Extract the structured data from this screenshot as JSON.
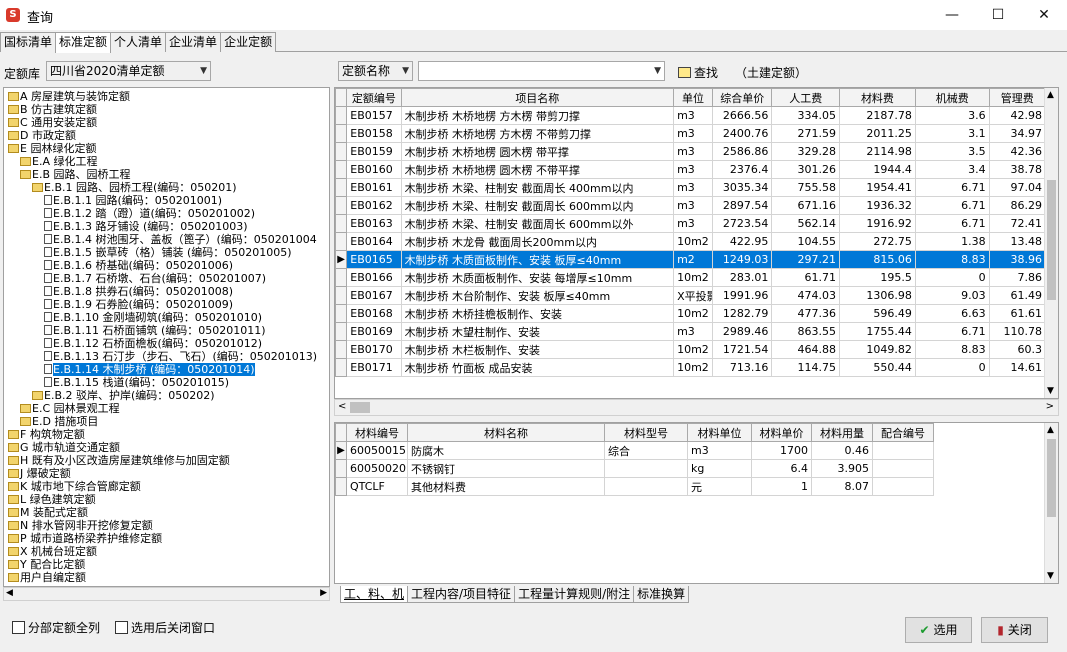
{
  "window": {
    "title": "查询",
    "min_icon": "—",
    "max_icon": "☐",
    "close_icon": "✕"
  },
  "tabs": [
    "国标清单",
    "标准定额",
    "个人清单",
    "企业清单",
    "企业定额"
  ],
  "active_tab": 1,
  "toolbar": {
    "library_label": "定额库",
    "library_value": "四川省2020清单定额",
    "search_field": "定额名称",
    "search_value": "",
    "find_label": "查找",
    "scope_label": "（土建定额）"
  },
  "tree": [
    {
      "d": 0,
      "t": "A 房屋建筑与装饰定额",
      "i": "folder"
    },
    {
      "d": 0,
      "t": "B 仿古建筑定额",
      "i": "folder"
    },
    {
      "d": 0,
      "t": "C 通用安装定额",
      "i": "folder"
    },
    {
      "d": 0,
      "t": "D 市政定额",
      "i": "folder"
    },
    {
      "d": 0,
      "t": "E 园林绿化定额",
      "i": "folder"
    },
    {
      "d": 1,
      "t": "E.A 绿化工程",
      "i": "folder"
    },
    {
      "d": 1,
      "t": "E.B 园路、园桥工程",
      "i": "folder"
    },
    {
      "d": 2,
      "t": "E.B.1 园路、园桥工程(编码：050201)",
      "i": "folder"
    },
    {
      "d": 3,
      "t": "E.B.1.1 园路(编码：050201001)",
      "i": "doc"
    },
    {
      "d": 3,
      "t": "E.B.1.2 踏（蹬）道(编码：050201002)",
      "i": "doc"
    },
    {
      "d": 3,
      "t": "E.B.1.3 路牙铺设 (编码：050201003)",
      "i": "doc"
    },
    {
      "d": 3,
      "t": "E.B.1.4 树池围牙、盖板（篦子）(编码：050201004",
      "i": "doc"
    },
    {
      "d": 3,
      "t": "E.B.1.5 嵌草砖（格）铺装 (编码：050201005)",
      "i": "doc"
    },
    {
      "d": 3,
      "t": "E.B.1.6 桥基础(编码：050201006)",
      "i": "doc"
    },
    {
      "d": 3,
      "t": "E.B.1.7 石桥墩、石台(编码：050201007)",
      "i": "doc"
    },
    {
      "d": 3,
      "t": "E.B.1.8 拱券石(编码：050201008)",
      "i": "doc"
    },
    {
      "d": 3,
      "t": "E.B.1.9 石券脸(编码：050201009)",
      "i": "doc"
    },
    {
      "d": 3,
      "t": "E.B.1.10 金刚墙砌筑(编码：050201010)",
      "i": "doc"
    },
    {
      "d": 3,
      "t": "E.B.1.11 石桥面铺筑 (编码：050201011)",
      "i": "doc"
    },
    {
      "d": 3,
      "t": "E.B.1.12 石桥面檐板(编码：050201012)",
      "i": "doc"
    },
    {
      "d": 3,
      "t": "E.B.1.13 石汀步（步石、飞石）(编码：050201013)",
      "i": "doc"
    },
    {
      "d": 3,
      "t": "E.B.1.14 木制步桥 (编码：050201014)",
      "i": "doc",
      "sel": true
    },
    {
      "d": 3,
      "t": "E.B.1.15 栈道(编码：050201015)",
      "i": "doc"
    },
    {
      "d": 2,
      "t": "E.B.2 驳岸、护岸(编码：050202)",
      "i": "folder"
    },
    {
      "d": 1,
      "t": "E.C 园林景观工程",
      "i": "folder"
    },
    {
      "d": 1,
      "t": "E.D 措施项目",
      "i": "folder"
    },
    {
      "d": 0,
      "t": "F 构筑物定额",
      "i": "folder"
    },
    {
      "d": 0,
      "t": "G 城市轨道交通定额",
      "i": "folder"
    },
    {
      "d": 0,
      "t": "H 既有及小区改造房屋建筑维修与加固定额",
      "i": "folder"
    },
    {
      "d": 0,
      "t": "J 爆破定额",
      "i": "folder"
    },
    {
      "d": 0,
      "t": "K 城市地下综合管廊定额",
      "i": "folder"
    },
    {
      "d": 0,
      "t": "L 绿色建筑定额",
      "i": "folder"
    },
    {
      "d": 0,
      "t": "M 装配式定额",
      "i": "folder"
    },
    {
      "d": 0,
      "t": "N 排水管网非开挖修复定额",
      "i": "folder"
    },
    {
      "d": 0,
      "t": "P 城市道路桥梁养护维修定额",
      "i": "folder"
    },
    {
      "d": 0,
      "t": "X 机械台班定额",
      "i": "folder"
    },
    {
      "d": 0,
      "t": "Y 配合比定额",
      "i": "folder"
    },
    {
      "d": 0,
      "t": "用户自编定额",
      "i": "folder"
    }
  ],
  "quota_table": {
    "headers": [
      "定额编号",
      "项目名称",
      "单位",
      "综合单价",
      "人工费",
      "材料费",
      "机械费",
      "管理费"
    ],
    "rows": [
      [
        "EB0157",
        "木制步桥 木桥地楞 方木楞 带剪刀撑",
        "m3",
        "2666.56",
        "334.05",
        "2187.78",
        "3.6",
        "42.98"
      ],
      [
        "EB0158",
        "木制步桥 木桥地楞 方木楞 不带剪刀撑",
        "m3",
        "2400.76",
        "271.59",
        "2011.25",
        "3.1",
        "34.97"
      ],
      [
        "EB0159",
        "木制步桥 木桥地楞 圆木楞 带平撑",
        "m3",
        "2586.86",
        "329.28",
        "2114.98",
        "3.5",
        "42.36"
      ],
      [
        "EB0160",
        "木制步桥 木桥地楞 圆木楞 不带平撑",
        "m3",
        "2376.4",
        "301.26",
        "1944.4",
        "3.4",
        "38.78"
      ],
      [
        "EB0161",
        "木制步桥 木梁、柱制安 截面周长 400mm以内",
        "m3",
        "3035.34",
        "755.58",
        "1954.41",
        "6.71",
        "97.04"
      ],
      [
        "EB0162",
        "木制步桥 木梁、柱制安 截面周长 600mm以内",
        "m3",
        "2897.54",
        "671.16",
        "1936.32",
        "6.71",
        "86.29"
      ],
      [
        "EB0163",
        "木制步桥 木梁、柱制安 截面周长 600mm以外",
        "m3",
        "2723.54",
        "562.14",
        "1916.92",
        "6.71",
        "72.41"
      ],
      [
        "EB0164",
        "木制步桥 木龙骨 截面周长200mm以内",
        "10m2",
        "422.95",
        "104.55",
        "272.75",
        "1.38",
        "13.48"
      ],
      [
        "EB0165",
        "木制步桥 木质面板制作、安装 板厚≤40mm",
        "m2",
        "1249.03",
        "297.21",
        "815.06",
        "8.83",
        "38.96"
      ],
      [
        "EB0166",
        "木制步桥 木质面板制作、安装 每增厚≤10mm",
        "10m2",
        "283.01",
        "61.71",
        "195.5",
        "0",
        "7.86"
      ],
      [
        "EB0167",
        "木制步桥 木台阶制作、安装 板厚≤40mm",
        "X平投影",
        "1991.96",
        "474.03",
        "1306.98",
        "9.03",
        "61.49"
      ],
      [
        "EB0168",
        "木制步桥 木桥挂檐板制作、安装",
        "10m2",
        "1282.79",
        "477.36",
        "596.49",
        "6.63",
        "61.61"
      ],
      [
        "EB0169",
        "木制步桥 木望柱制作、安装",
        "m3",
        "2989.46",
        "863.55",
        "1755.44",
        "6.71",
        "110.78"
      ],
      [
        "EB0170",
        "木制步桥 木栏板制作、安装",
        "10m2",
        "1721.54",
        "464.88",
        "1049.82",
        "8.83",
        "60.3"
      ],
      [
        "EB0171",
        "木制步桥 竹面板 成品安装",
        "10m2",
        "713.16",
        "114.75",
        "550.44",
        "0",
        "14.61"
      ]
    ],
    "selected_index": 8
  },
  "material_table": {
    "headers": [
      "材料编号",
      "材料名称",
      "材料型号",
      "材料单位",
      "材料单价",
      "材料用量",
      "配合编号"
    ],
    "rows": [
      [
        "60050015",
        "防腐木",
        "综合",
        "m3",
        "1700",
        "0.46",
        ""
      ],
      [
        "60050020",
        "不锈钢钉",
        "",
        "kg",
        "6.4",
        "3.905",
        ""
      ],
      [
        "QTCLF",
        "其他材料费",
        "",
        "元",
        "1",
        "8.07",
        ""
      ]
    ]
  },
  "bottom_tabs": [
    "工、料、机",
    "工程内容/项目特征",
    "工程量计算规则/附注",
    "标准换算"
  ],
  "options": {
    "expand_all": "分部定额全列",
    "close_after": "选用后关闭窗口"
  },
  "buttons": {
    "select": "选用",
    "close": "关闭"
  },
  "colors": {
    "selection": "#0078d7",
    "folder": "#f2d46c",
    "check_icon": "#1c9b2f",
    "close_icon": "#b3262d"
  }
}
